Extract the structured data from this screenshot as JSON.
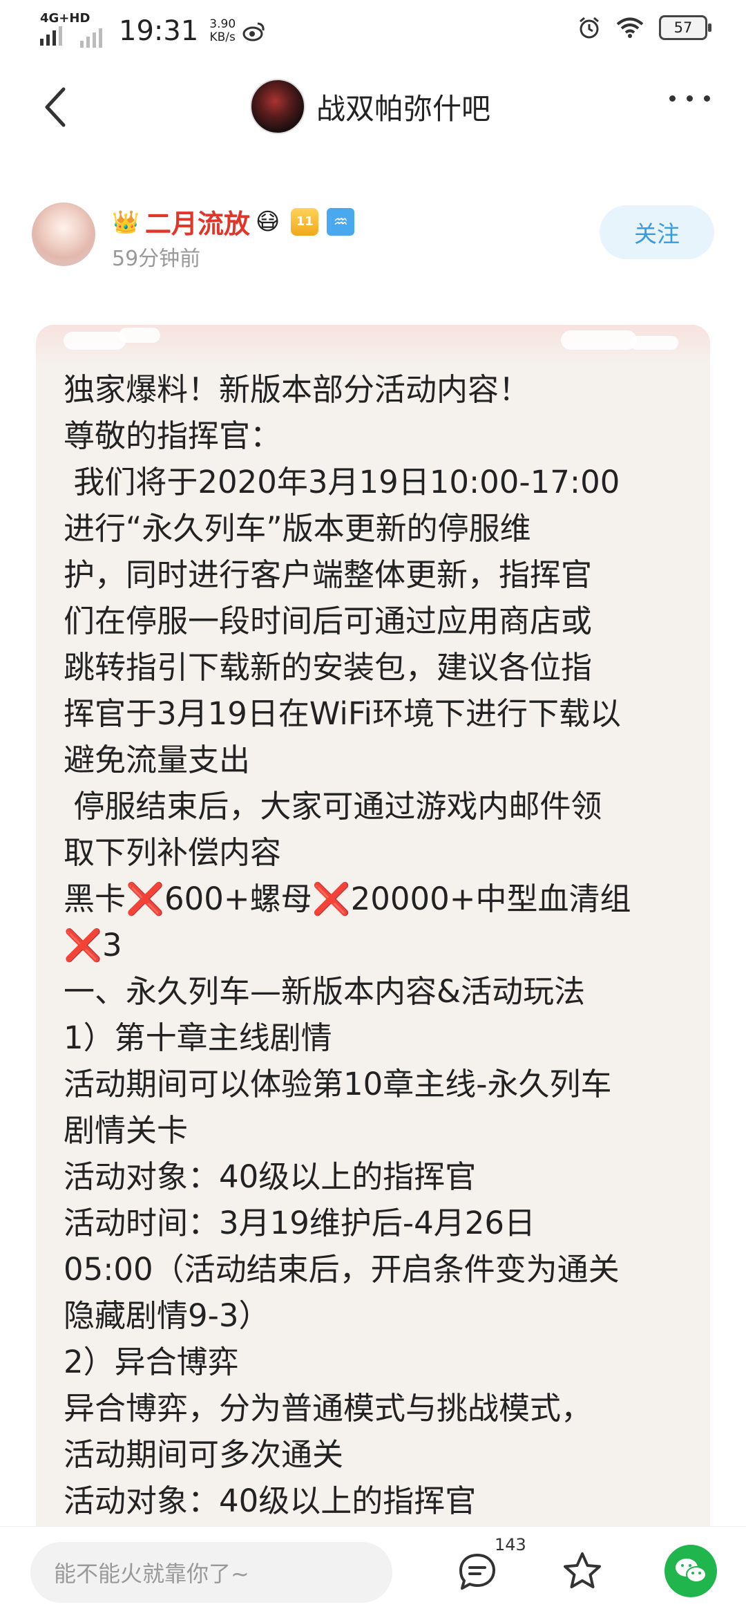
{
  "status_bar": {
    "network": "4G+HD",
    "time": "19:31",
    "speed_value": "3.90",
    "speed_unit": "KB/s",
    "battery": "57"
  },
  "nav": {
    "forum_name": "战双帕弥什吧"
  },
  "post": {
    "author_name": "二月流放",
    "author_level": "11",
    "time_ago": "59分钟前",
    "follow_label": "关注",
    "body": "独家爆料！新版本部分活动内容！\n尊敬的指挥官：\n 我们将于2020年3月19日10:00-17:00\n进行“永久列车”版本更新的停服维\n护，同时进行客户端整体更新，指挥官\n们在停服一段时间后可通过应用商店或\n跳转指引下载新的安装包，建议各位指\n挥官于3月19日在WiFi环境下进行下载以\n避免流量支出\n 停服结束后，大家可通过游戏内邮件领\n取下列补偿内容\n黑卡❌600+螺母❌20000+中型血清组\n❌3\n一、永久列车—新版本内容&活动玩法\n1）第十章主线剧情\n活动期间可以体验第10章主线-永久列车\n剧情关卡\n活动对象：40级以上的指挥官\n活动时间：3月19维护后-4月26日\n05:00（活动结束后，开启条件变为通关\n隐藏剧情9-3）\n2）异合博弈\n异合博弈，分为普通模式与挑战模式，\n活动期间可多次通关\n活动对象：40级以上的指挥官"
  },
  "bottom_bar": {
    "reply_placeholder": "能不能火就靠你了~",
    "comment_count": "143"
  },
  "colors": {
    "username": "#e2352a",
    "follow_text": "#3a9bdc",
    "follow_bg": "#e8f4fc",
    "card_bg": "#f5f2ee",
    "wechat_green": "#20b54d"
  }
}
